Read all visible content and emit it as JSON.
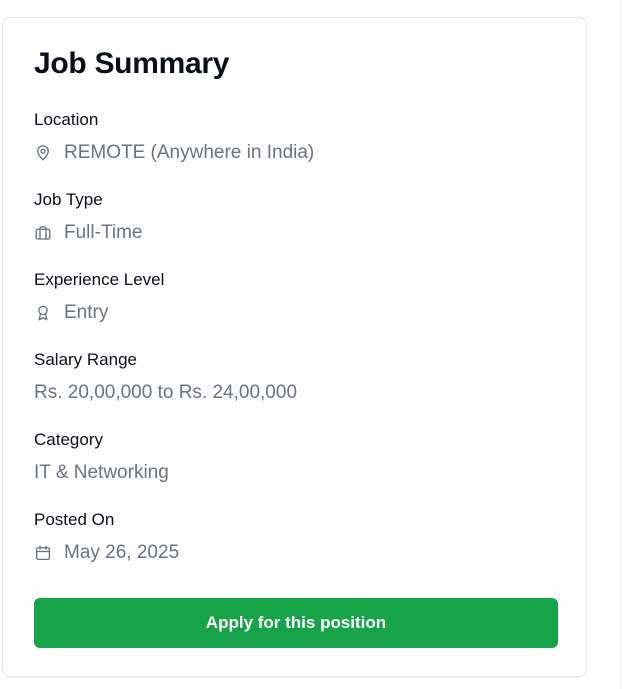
{
  "card": {
    "title": "Job Summary",
    "fields": [
      {
        "label": "Location",
        "value": "REMOTE (Anywhere in India)",
        "icon": "map-pin-icon"
      },
      {
        "label": "Job Type",
        "value": "Full-Time",
        "icon": "briefcase-icon"
      },
      {
        "label": "Experience Level",
        "value": "Entry",
        "icon": "award-icon"
      },
      {
        "label": "Salary Range",
        "value": "Rs. 20,00,000 to Rs. 24,00,000",
        "icon": ""
      },
      {
        "label": "Category",
        "value": "IT & Networking",
        "icon": ""
      },
      {
        "label": "Posted On",
        "value": "May 26, 2025",
        "icon": "calendar-icon"
      }
    ],
    "apply_label": "Apply for this position"
  },
  "colors": {
    "title": "#0b0f19",
    "label": "#0b0f19",
    "value": "#6b7280",
    "button_bg": "#16a34a",
    "button_text": "#ffffff",
    "border": "#e5e7eb"
  }
}
